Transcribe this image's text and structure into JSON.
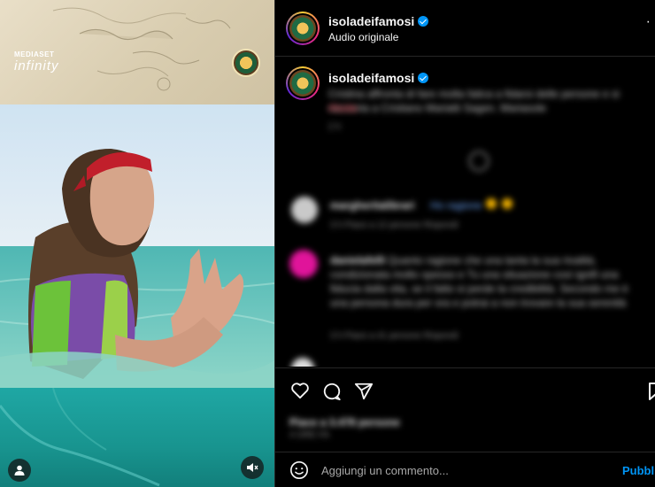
{
  "media": {
    "brand_top": "MEDIASET",
    "brand_bottom": "infinity",
    "icons": {
      "profile": "user-icon",
      "mute": "speaker-muted-icon"
    }
  },
  "header": {
    "username": "isoladeifamosi",
    "subtitle": "Audio originale",
    "more": "·"
  },
  "caption": {
    "username": "isoladeifamosi",
    "text": "Cristina affronta di fare molta fatica a fidarsi delle persone e si racconta a Cristiano Mariatti Sagen. Mariasole",
    "text2": "#Isola",
    "time": "2 h"
  },
  "comments": [
    {
      "username": "margheritalibrari",
      "text": "Ho ragione",
      "meta": "3 h    Piace a 12 persone    Rispondi"
    },
    {
      "username": "danielafelli",
      "text": "Quanto ragione che una tanta la sua rivalità, condizionata molto spesso e Tu una situazione così ignifi una fiducia dalla vita, se il fatto si perde la credibilità. Secondo me è una persona dura per ora e potrai a non trovare la sua serenità",
      "meta": "3 h    Piace a 41 persone    Rispondi"
    }
  ],
  "actions": {
    "icons": [
      "heart-icon",
      "comment-icon",
      "share-icon",
      "bookmark-icon"
    ],
    "likes": "Piace a 3.478 persone",
    "date": "4 ORE FA"
  },
  "comment_box": {
    "placeholder": "Aggiungi un commento...",
    "publish": "Pubblica",
    "icon": "emoji-icon"
  },
  "colors": {
    "accent": "#0095f6",
    "background": "#000000",
    "divider": "#262626"
  }
}
